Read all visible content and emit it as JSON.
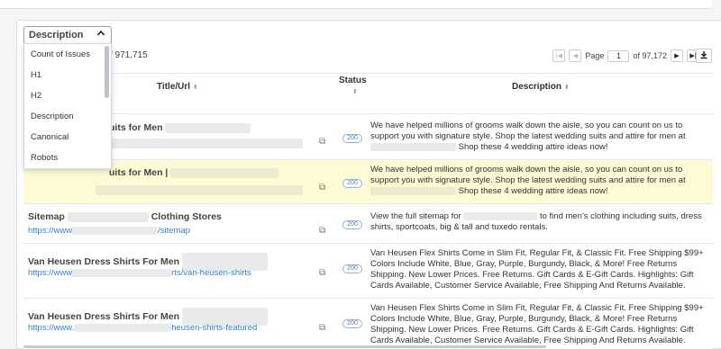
{
  "filter": {
    "selected": "Description",
    "options": [
      "Count of Issues",
      "H1",
      "H2",
      "Description",
      "Canonical",
      "Robots"
    ]
  },
  "count_text": "f 971,715",
  "pager": {
    "page_label": "Page",
    "current_page": "1",
    "total": "of 97,172"
  },
  "table": {
    "headers": {
      "title_url": "Title/Url",
      "status": "Status",
      "description": "Description"
    },
    "rows": [
      {
        "title": "uits for Men",
        "url": "",
        "status": "200",
        "desc": "We have helped millions of grooms walk down the aisle, so you can count on us to support you with signature style. Shop the latest wedding suits and attire for men at",
        "desc_tail": "Shop these 4 wedding attire ideas now!"
      },
      {
        "title": "uits for Men |",
        "url": "",
        "status": "200",
        "desc": "We have helped millions of grooms walk down the aisle, so you can count on us to support you with signature style. Shop the latest wedding suits and attire for men at",
        "desc_tail": "Shop these 4 wedding attire ideas now!"
      },
      {
        "title_a": "Sitemap",
        "title_b": "Clothing Stores",
        "url_a": "https://www",
        "url_b": "/sitemap",
        "status": "200",
        "desc_a": "View the full sitemap for",
        "desc_b": "to find men's clothing including suits, dress shirts, sportcoats, big & tall and tuxedo rentals."
      },
      {
        "title": "Van Heusen Dress Shirts For Men",
        "url_a": "https://www",
        "url_b": "rts/van-heusen-shirts",
        "status": "200",
        "desc": "Van Heusen Flex Shirts Come in Slim Fit, Regular Fit, & Classic Fit. Free Shipping $99+ Colors Include White, Blue, Gray, Purple, Burgundy, Black, & More! Free Returns Shipping. New Lower Prices. Free Returns. Gift Cards & E-Gift Cards. Highlights: Gift Cards Available, Customer Service Available, Free Shipping And Returns Available."
      },
      {
        "title": "Van Heusen Dress Shirts For Men",
        "url_a": "https://www.",
        "url_b": "heusen-shirts-featured",
        "status": "200",
        "desc": "Van Heusen Flex Shirts Come in Slim Fit, Regular Fit, & Classic Fit. Free Shipping $99+ Colors Include White, Blue, Gray, Purple, Burgundy, Black, & More! Free Returns Shipping. New Lower Prices. Free Returns. Gift Cards & E-Gift Cards. Highlights: Gift Cards Available, Customer Service Available, Free Shipping And Returns Available."
      }
    ]
  },
  "icons": {
    "caret": "chevron-up-icon",
    "external": "external-link-icon",
    "download": "download-icon"
  },
  "colors": {
    "link": "#2f7fd4",
    "highlight_row": "#fcfbd6",
    "status_badge": "#4a7fc1"
  }
}
